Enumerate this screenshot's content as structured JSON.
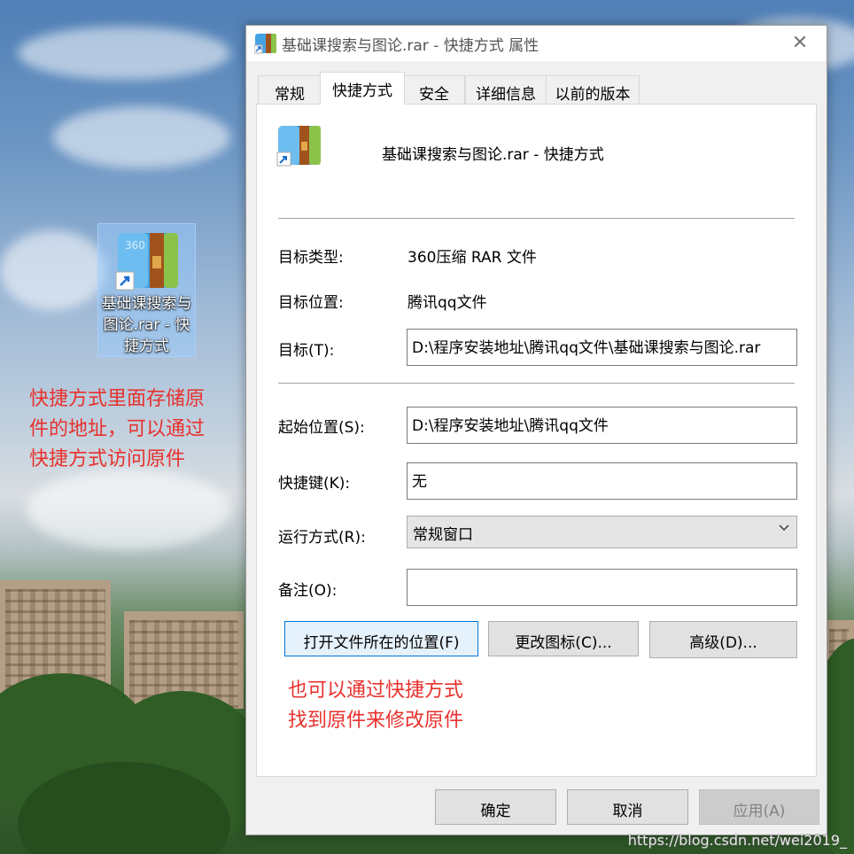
{
  "desktop": {
    "icon_label": "基础课搜索与图论.rar - 快捷方式",
    "note_left_lines": [
      "快捷方式里面存储原",
      "件的地址，可以通过",
      "快捷方式访问原件"
    ],
    "note_dialog_lines": [
      "也可以通过快捷方式",
      "找到原件来修改原件"
    ],
    "watermark": "https://blog.csdn.net/wei2019_"
  },
  "dialog": {
    "title": "基础课搜索与图论.rar - 快捷方式 属性",
    "close_glyph": "✕",
    "tabs": [
      "常规",
      "快捷方式",
      "安全",
      "详细信息",
      "以前的版本"
    ],
    "active_tab": "快捷方式",
    "header_name": "基础课搜索与图论.rar - 快捷方式",
    "target_type_label": "目标类型:",
    "target_type_value": "360压缩 RAR 文件",
    "target_location_label": "目标位置:",
    "target_location_value": "腾讯qq文件",
    "target_label": "目标(T):",
    "target_value": "D:\\程序安装地址\\腾讯qq文件\\基础课搜索与图论.rar",
    "start_in_label": "起始位置(S):",
    "start_in_value": "D:\\程序安装地址\\腾讯qq文件",
    "hotkey_label": "快捷键(K):",
    "hotkey_value": "无",
    "run_label": "运行方式(R):",
    "run_value": "常规窗口",
    "comment_label": "备注(O):",
    "comment_value": "",
    "open_location_button": "打开文件所在的位置(F)",
    "change_icon_button": "更改图标(C)...",
    "advanced_button": "高级(D)...",
    "ok_button": "确定",
    "cancel_button": "取消",
    "apply_button": "应用(A)"
  },
  "colors": {
    "annotation_red": "#e8312d",
    "focus_blue": "#0078d7"
  },
  "icons": [
    "winrar-archive-icon",
    "shortcut-arrow-icon",
    "close-icon",
    "chevron-down-icon"
  ]
}
